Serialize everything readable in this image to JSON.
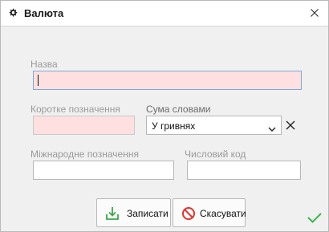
{
  "window": {
    "title": "Валюта",
    "title_icon": "gear-icon",
    "close_icon": "close-icon"
  },
  "form": {
    "name_label": "Назва",
    "name_value": "",
    "short_label": "Коротке позначення",
    "short_value": "",
    "words_label": "Сума словами",
    "words_value": "У гривнях",
    "intl_label": "Міжнародне позначення",
    "intl_value": "",
    "code_label": "Числовий код",
    "code_value": ""
  },
  "buttons": {
    "save_label": "Записати",
    "cancel_label": "Скасувати"
  },
  "colors": {
    "required_bg": "#ffe0e0",
    "save_icon": "#3aa84a",
    "cancel_icon": "#e0322d",
    "status_check": "#3cb44b"
  },
  "icons": {
    "save": "download-icon",
    "cancel": "prohibited-icon",
    "status": "checkmark-icon"
  }
}
